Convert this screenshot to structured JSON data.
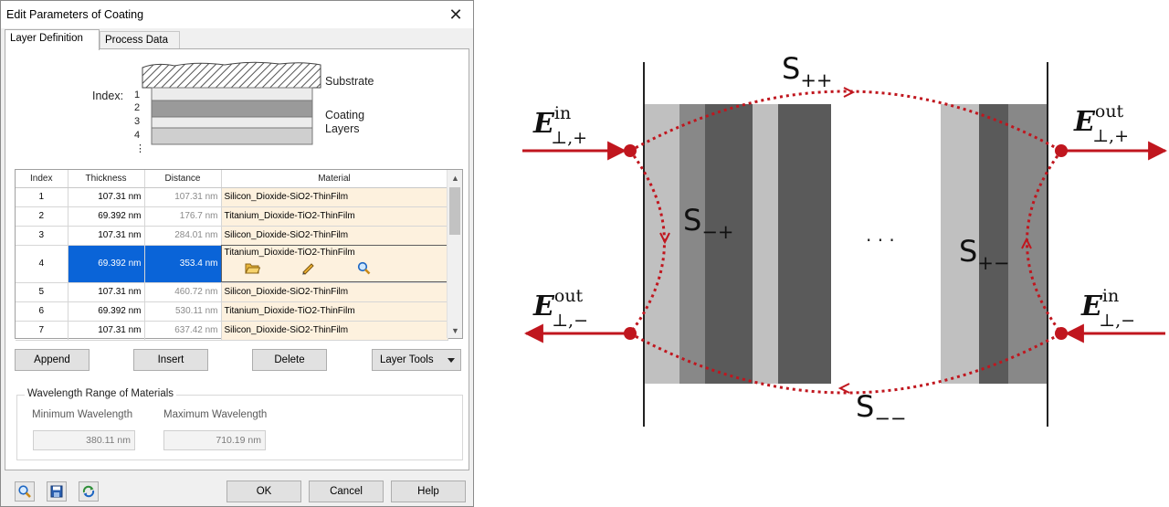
{
  "dialog": {
    "title": "Edit Parameters of Coating",
    "close_glyph": "✕",
    "tabs": [
      {
        "label": "Layer Definition",
        "active": true
      },
      {
        "label": "Process Data",
        "active": false
      }
    ],
    "diagram": {
      "index_label": "Index:",
      "indices": [
        "1",
        "2",
        "3",
        "4",
        "⋮"
      ],
      "substrate_label": "Substrate",
      "coating_label_1": "Coating",
      "coating_label_2": "Layers"
    },
    "table": {
      "headers": [
        "Index",
        "Thickness",
        "Distance",
        "Material"
      ],
      "rows": [
        {
          "index": "1",
          "thickness": "107.31 nm",
          "distance": "107.31 nm",
          "material": "Silicon_Dioxide-SiO2-ThinFilm"
        },
        {
          "index": "2",
          "thickness": "69.392 nm",
          "distance": "176.7 nm",
          "material": "Titanium_Dioxide-TiO2-ThinFilm"
        },
        {
          "index": "3",
          "thickness": "107.31 nm",
          "distance": "284.01 nm",
          "material": "Silicon_Dioxide-SiO2-ThinFilm"
        },
        {
          "index": "4",
          "thickness": "69.392 nm",
          "distance": "353.4 nm",
          "material": "Titanium_Dioxide-TiO2-ThinFilm"
        },
        {
          "index": "5",
          "thickness": "107.31 nm",
          "distance": "460.72 nm",
          "material": "Silicon_Dioxide-SiO2-ThinFilm"
        },
        {
          "index": "6",
          "thickness": "69.392 nm",
          "distance": "530.11 nm",
          "material": "Titanium_Dioxide-TiO2-ThinFilm"
        },
        {
          "index": "7",
          "thickness": "107.31 nm",
          "distance": "637.42 nm",
          "material": "Silicon_Dioxide-SiO2-ThinFilm"
        }
      ],
      "selected_row_index": "4"
    },
    "buttons": {
      "append": "Append",
      "insert": "Insert",
      "delete": "Delete",
      "layer_tools": "Layer Tools"
    },
    "wavelength": {
      "group_title": "Wavelength Range of Materials",
      "min_label": "Minimum Wavelength",
      "max_label": "Maximum Wavelength",
      "min_value": "380.11 nm",
      "max_value": "710.19 nm"
    },
    "footer": {
      "ok": "OK",
      "cancel": "Cancel",
      "help": "Help"
    },
    "icons": [
      "search-icon",
      "save-icon",
      "refresh-icon",
      "folder-icon",
      "pencil-icon",
      "magnifier-icon"
    ]
  },
  "figure": {
    "s_pp": "S",
    "s_pp_sub": "++",
    "s_mp": "S",
    "s_mp_sub": "−+",
    "s_pm": "S",
    "s_pm_sub": "+−",
    "s_mm": "S",
    "s_mm_sub": "−−",
    "e_in_plus": "E",
    "e_in_plus_sup": "in",
    "e_in_plus_sub": "⊥,+",
    "e_out_plus": "E",
    "e_out_plus_sup": "out",
    "e_out_plus_sub": "⊥,+",
    "e_out_minus": "E",
    "e_out_minus_sup": "out",
    "e_out_minus_sub": "⊥,−",
    "e_in_minus": "E",
    "e_in_minus_sup": "in",
    "e_in_minus_sub": "⊥,−",
    "ellipsis": "· · ·",
    "colors": {
      "accent": "#c0161e",
      "dark_layer": "#5a5a5a",
      "mid_layer": "#888888",
      "light_layer": "#c0c0c0"
    }
  }
}
